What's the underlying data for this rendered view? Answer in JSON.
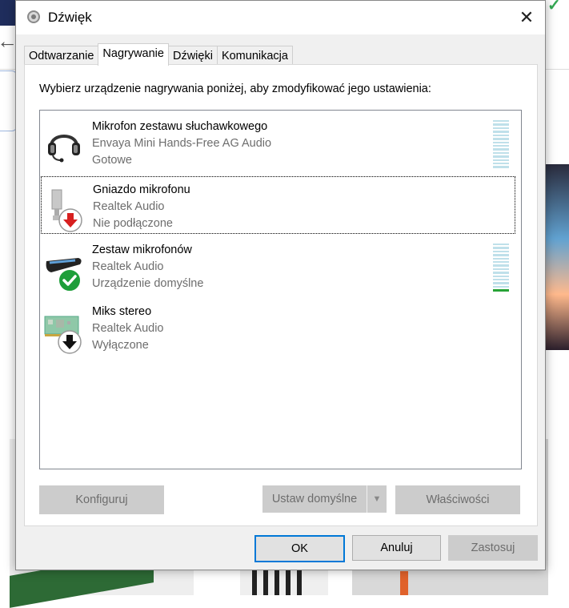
{
  "dialog": {
    "title": "Dźwięk",
    "close_label": "✕"
  },
  "tabs": [
    {
      "label": "Odtwarzanie",
      "active": false
    },
    {
      "label": "Nagrywanie",
      "active": true
    },
    {
      "label": "Dźwięki",
      "active": false
    },
    {
      "label": "Komunikacja",
      "active": false
    }
  ],
  "instruction": "Wybierz urządzenie nagrywania poniżej, aby zmodyfikować jego ustawienia:",
  "devices": [
    {
      "name": "Mikrofon zestawu słuchawkowego",
      "driver": "Envaya Mini Hands-Free AG Audio",
      "status": "Gotowe",
      "icon": "headset-icon",
      "badge": null,
      "level": 0
    },
    {
      "name": "Gniazdo mikrofonu",
      "driver": "Realtek Audio",
      "status": "Nie podłączone",
      "icon": "mic-jack-icon",
      "badge": "unplugged-red-arrow",
      "level": null
    },
    {
      "name": "Zestaw mikrofonów",
      "driver": "Realtek Audio",
      "status": "Urządzenie domyślne",
      "icon": "mic-array-icon",
      "badge": "default-green-check",
      "level": 0.05
    },
    {
      "name": "Miks stereo",
      "driver": "Realtek Audio",
      "status": "Wyłączone",
      "icon": "sound-card-icon",
      "badge": "disabled-black-arrow",
      "level": null
    }
  ],
  "buttons": {
    "configure": "Konfiguruj",
    "set_default": "Ustaw domyślne",
    "properties": "Właściwości"
  },
  "footer": {
    "ok": "OK",
    "cancel": "Anuluj",
    "apply": "Zastosuj"
  },
  "colors": {
    "accent": "#0078d7",
    "meter_idle": "#bfe0ea",
    "meter_active": "#27a337",
    "disabled_button": "#cccccc"
  }
}
